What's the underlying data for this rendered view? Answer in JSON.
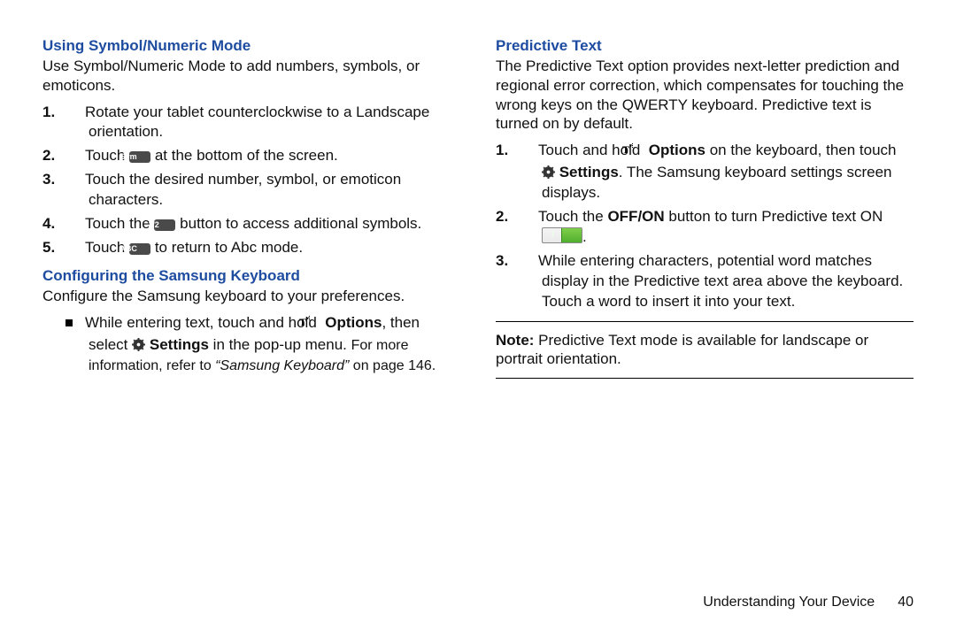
{
  "left": {
    "sec1": {
      "heading": "Using Symbol/Numeric Mode",
      "intro": "Use Symbol/Numeric Mode to add numbers, symbols, or emoticons.",
      "steps": {
        "n1": "1.",
        "s1": "Rotate your tablet counterclockwise to a Landscape orientation.",
        "n2": "2.",
        "s2a": "Touch ",
        "key2": "Sym",
        "s2b": " at the bottom of the screen.",
        "n3": "3.",
        "s3": "Touch the desired number, symbol, or emoticon characters.",
        "n4": "4.",
        "s4a": "Touch the ",
        "key4": "1/2",
        "s4b": " button to access additional symbols.",
        "n5": "5.",
        "s5a": "Touch ",
        "key5": "ABC",
        "s5b": " to return to Abc mode."
      }
    },
    "sec2": {
      "heading": "Configuring the Samsung Keyboard",
      "intro": "Configure the Samsung keyboard to your preferences.",
      "bullet": {
        "b1a": "While entering text, touch and hold ",
        "opt": " Options",
        "b1b": ", then select ",
        "set": " Settings",
        "b1c": " in the pop-up menu. ",
        "more1": "For more information, refer to ",
        "ref": "“Samsung Keyboard”",
        "more2": " on page 146."
      }
    }
  },
  "right": {
    "sec1": {
      "heading": "Predictive Text",
      "intro": "The Predictive Text option provides next-letter prediction and regional error correction, which compensates for touching the wrong keys on the QWERTY keyboard. Predictive text is turned on by default.",
      "steps": {
        "n1": "1.",
        "s1a": "Touch and hold ",
        "opt": " Options",
        "s1b": " on the keyboard, then touch ",
        "set": " Settings",
        "s1c": ". The Samsung keyboard settings screen displays.",
        "n2": "2.",
        "s2a": "Touch the ",
        "offon": "OFF/ON",
        "s2b": " button to turn Predictive text ON ",
        "s2c": ".",
        "n3": "3.",
        "s3": "While entering characters, potential word matches display in the Predictive text area above the keyboard. Touch a word to insert it into your text."
      }
    },
    "note": {
      "label": "Note:",
      "text": " Predictive Text mode is available for landscape or portrait orientation."
    }
  },
  "footer": {
    "section": "Understanding Your Device",
    "page": "40"
  }
}
